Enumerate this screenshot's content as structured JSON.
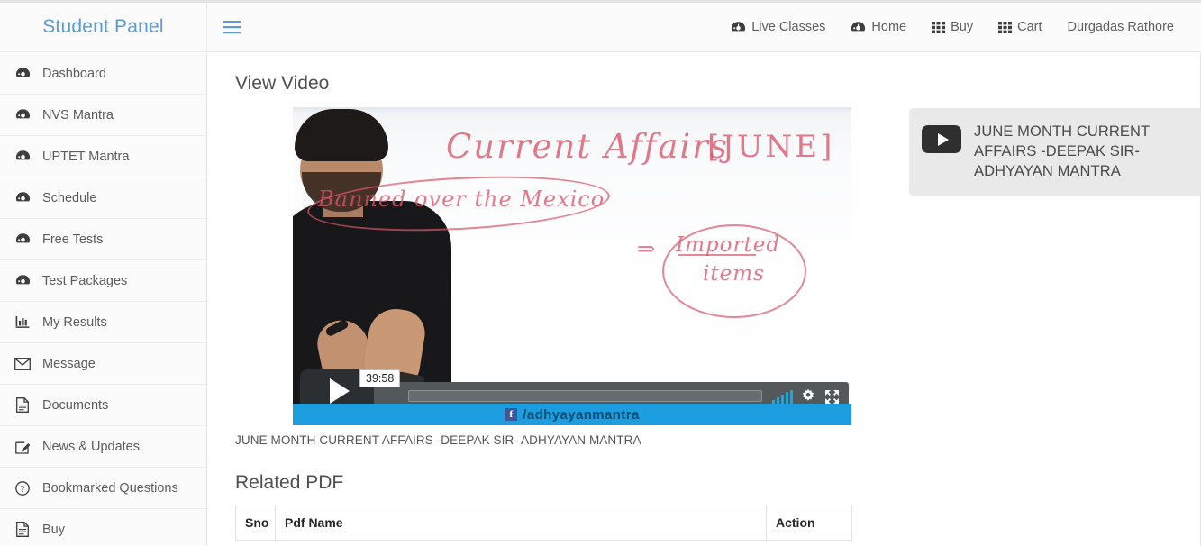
{
  "header": {
    "brand": "Student Panel",
    "menu_icon": "hamburger-icon",
    "nav": [
      {
        "label": "Live Classes",
        "icon": "tachometer-icon"
      },
      {
        "label": "Home",
        "icon": "tachometer-icon"
      },
      {
        "label": "Buy",
        "icon": "grid-icon"
      },
      {
        "label": "Cart",
        "icon": "grid-icon"
      },
      {
        "label": "Durgadas Rathore",
        "icon": ""
      }
    ]
  },
  "sidebar": {
    "items": [
      {
        "label": "Dashboard",
        "icon": "tachometer-icon"
      },
      {
        "label": "NVS Mantra",
        "icon": "tachometer-icon"
      },
      {
        "label": "UPTET Mantra",
        "icon": "tachometer-icon"
      },
      {
        "label": "Schedule",
        "icon": "tachometer-icon"
      },
      {
        "label": "Free Tests",
        "icon": "tachometer-icon"
      },
      {
        "label": "Test Packages",
        "icon": "tachometer-icon"
      },
      {
        "label": "My Results",
        "icon": "bar-chart-icon"
      },
      {
        "label": "Message",
        "icon": "envelope-icon"
      },
      {
        "label": "Documents",
        "icon": "file-icon"
      },
      {
        "label": "News & Updates",
        "icon": "pencil-square-icon"
      },
      {
        "label": "Bookmarked Questions",
        "icon": "question-circle-icon"
      },
      {
        "label": "Buy",
        "icon": "file-icon"
      }
    ]
  },
  "main": {
    "page_title": "View Video",
    "video": {
      "caption": "JUNE MONTH CURRENT AFFAIRS -DEEPAK SIR- ADHYAYAN MANTRA",
      "time_tooltip": "39:58",
      "play_icon": "play-icon",
      "settings_icon": "gear-icon",
      "fullscreen_icon": "fullscreen-icon",
      "volume_icon": "volume-bars-icon",
      "whiteboard": {
        "title": "Current Affairs",
        "month": "[JUNE]",
        "note_left": "Banned over the Mexico",
        "arrow": "⇒",
        "note_right_line1": "Imported",
        "note_right_line2": "items"
      },
      "watermark": {
        "fb_glyph": "f",
        "handle": "/adhyayanmantra"
      }
    },
    "related_pdf": {
      "title": "Related PDF",
      "columns": [
        "Sno",
        "Pdf Name",
        "Action"
      ],
      "rows": []
    }
  },
  "playlist": {
    "items": [
      {
        "title": "JUNE MONTH CURRENT AFFAIRS -DEEPAK SIR- ADHYAYAN MANTRA",
        "icon": "play-icon"
      }
    ]
  },
  "colors": {
    "brand_blue": "#5b9bd5",
    "banner_blue": "#1b9de0",
    "card_gray": "#e9e9e9",
    "header_bg": "#fbfbfb"
  }
}
